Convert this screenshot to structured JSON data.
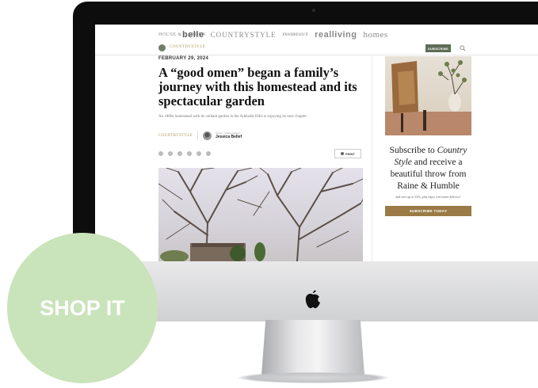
{
  "site": {
    "brands": [
      "HOUSE & GARDEN",
      "belle",
      "COUNTRYSTYLE",
      "INSIDEOUT",
      "realliving",
      "homes"
    ],
    "logo_word": "COUNTRYSTYLE",
    "subscribe_label": "SUBSCRIBE"
  },
  "article": {
    "date": "FEBRUARY 29, 2024",
    "headline": "A “good omen” began a family’s journey with this homestead and its spectacular garden",
    "standfirst": "An 1860s homestead with its verdant garden in the Adelaide Hills is enjoying its next chapter.",
    "byline_brand": "COUNTRYSTYLE",
    "byline_role": "Words / Photographer",
    "byline_name": "Jessica Bellef",
    "share_icons": [
      "facebook-icon",
      "x-icon",
      "pinterest-icon",
      "linkedin-icon",
      "email-icon",
      "link-icon"
    ],
    "print_label": "PRINT"
  },
  "sidebar": {
    "promo_line1": "Subscribe to",
    "promo_em": "Country Style",
    "promo_line2": "and receive a beautiful throw from Raine & Humble",
    "promo_sub": "and save up to 52%, plus enjoy free home delivery!",
    "promo_button": "SUBSCRIBE TODAY"
  },
  "badge": {
    "label": "SHOP IT",
    "color": "#c9e3bb"
  },
  "colors": {
    "accent_green": "#5f6d57",
    "accent_gold": "#9a7a45"
  }
}
